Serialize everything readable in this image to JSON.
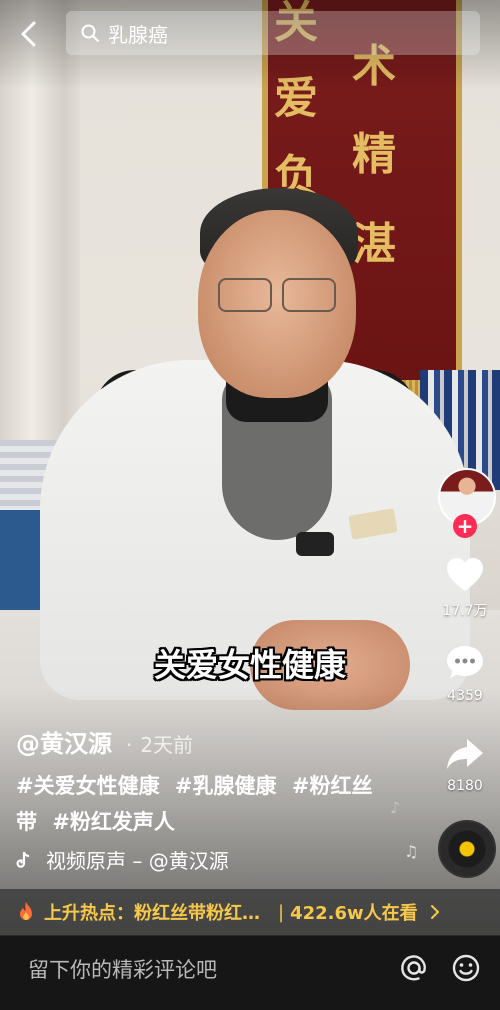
{
  "search": {
    "query": "乳腺癌"
  },
  "video": {
    "caption": "关爱女性健康"
  },
  "banner_chars": [
    "关",
    "术",
    "爱",
    "精",
    "负",
    "湛"
  ],
  "actions": {
    "likes": "17.7万",
    "comments": "4359",
    "shares": "8180",
    "follow_symbol": "+"
  },
  "post": {
    "author": "@黄汉源",
    "time": "2天前",
    "hashtags": [
      "#关爱女性健康",
      "#乳腺健康",
      "#粉红丝带",
      "#粉红发声人"
    ],
    "music": "视频原声 – @黄汉源"
  },
  "hot": {
    "label": "上升热点：",
    "title": "粉红丝带粉红…",
    "separator": "|",
    "viewers": "422.6w人在看"
  },
  "comment": {
    "placeholder": "留下你的精彩评论吧"
  },
  "icons": {
    "back": "chevron-left-icon",
    "search": "search-icon",
    "like": "heart-icon",
    "comment": "comment-bubble-icon",
    "share": "share-arrow-icon",
    "music": "music-note-icon",
    "hot": "flame-icon",
    "mention": "at-icon",
    "emoji": "smiley-icon"
  },
  "colors": {
    "accent_red": "#fe2c55",
    "hot_yellow": "#f7c84a",
    "disc_yellow": "#f5c400"
  }
}
